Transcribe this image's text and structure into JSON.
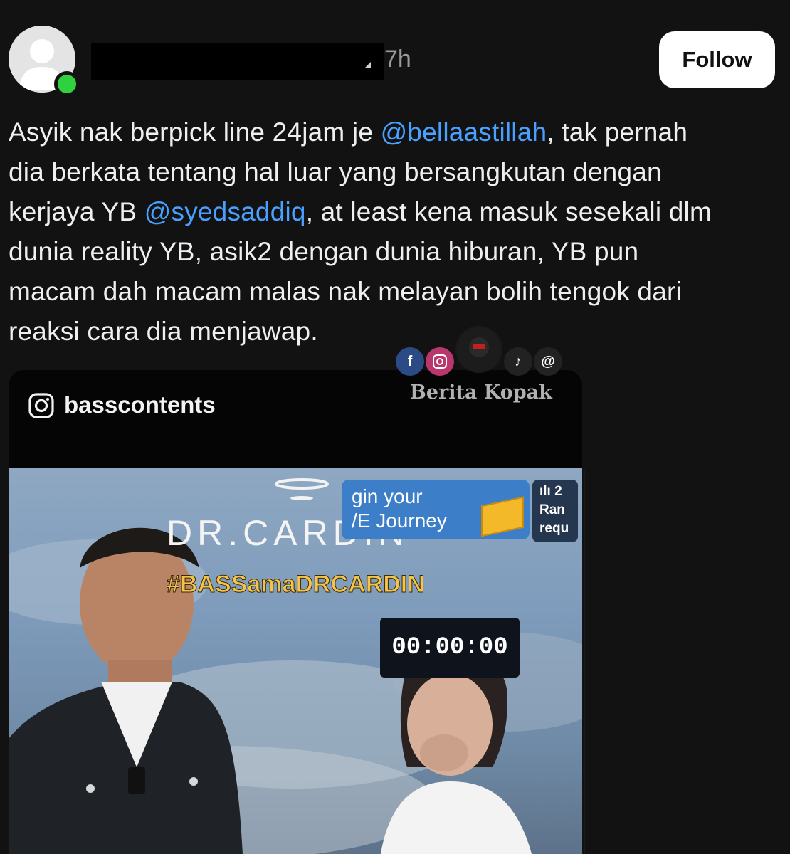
{
  "post": {
    "timestamp": "7h",
    "follow_label": "Follow",
    "lines": [
      {
        "before": "Asyik nak berpick line 24jam je ",
        "mention": "@bellaastillah",
        "after": ",  tak pernah"
      },
      {
        "before": "dia berkata tentang hal luar yang bersangkutan dengan",
        "mention": "",
        "after": ""
      },
      {
        "before": "kerjaya YB ",
        "mention": "@syedsaddiq",
        "after": ",  at least kena masuk sesekali dlm"
      },
      {
        "before": "dunia reality YB, asik2 dengan dunia hiburan,  YB pun",
        "mention": "",
        "after": ""
      },
      {
        "before": "macam dah macam malas nak melayan bolih tengok dari",
        "mention": "",
        "after": ""
      },
      {
        "before": "reaksi cara dia menjawap.",
        "mention": "",
        "after": ""
      }
    ]
  },
  "watermark": {
    "text": "Berita Kopak",
    "icons": [
      "facebook-icon",
      "instagram-icon",
      "tiktok-icon",
      "threads-icon"
    ]
  },
  "embed": {
    "username": "basscontents",
    "video": {
      "brand": "DR.CARDIN",
      "hashtag": "#BASSamaDRCARDIN",
      "ad_line1": "gin your",
      "ad_line2": "/E Journey",
      "side_card_lines": [
        "ılı 2",
        "Ran",
        "requ"
      ],
      "timer": "00:00:00"
    }
  },
  "colors": {
    "background": "#121212",
    "mention": "#4aa0ff",
    "online": "#2fd13e",
    "hashtag": "#f3c34c"
  }
}
